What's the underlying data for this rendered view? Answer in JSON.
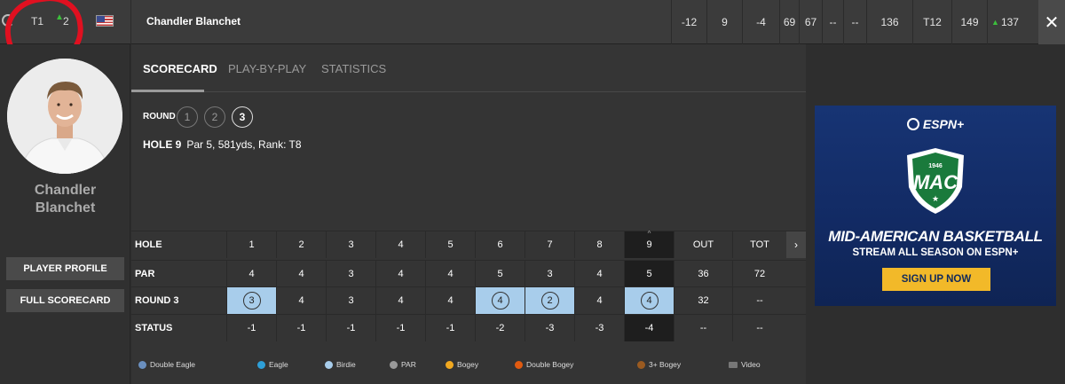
{
  "topbar": {
    "position": "T1",
    "movement": "2",
    "player_name": "Chandler Blanchet",
    "stats": [
      {
        "value": "-12",
        "w": 40
      },
      {
        "value": "9",
        "w": 40
      },
      {
        "value": "-4",
        "w": 42
      },
      {
        "value": "69",
        "w": 22
      },
      {
        "value": "67",
        "w": 26
      },
      {
        "value": "--",
        "w": 24
      },
      {
        "value": "--",
        "w": 26
      },
      {
        "value": "136",
        "w": 52
      },
      {
        "value": "T12",
        "w": 44
      },
      {
        "value": "149",
        "w": 40
      },
      {
        "value": "137",
        "w": 40,
        "up": true
      }
    ],
    "close_icon": "close-icon",
    "colors": {
      "movement_up": "#3cbf3c",
      "annotation": "#e01020"
    }
  },
  "player": {
    "name": "Chandler Blanchet",
    "buttons": {
      "profile": "PLAYER PROFILE",
      "scorecard": "FULL SCORECARD"
    }
  },
  "tabs": [
    "SCORECARD",
    "PLAY-BY-PLAY",
    "STATISTICS"
  ],
  "round": {
    "label": "ROUND",
    "options": [
      "1",
      "2",
      "3"
    ],
    "selected": "3"
  },
  "hole_info": {
    "hole": "HOLE 9",
    "detail": "Par 5, 581yds, Rank: T8"
  },
  "scorecard": {
    "row_labels": [
      "HOLE",
      "PAR",
      "ROUND 3",
      "STATUS"
    ],
    "holes": [
      "1",
      "2",
      "3",
      "4",
      "5",
      "6",
      "7",
      "8",
      "9",
      "OUT",
      "TOT"
    ],
    "par": [
      "4",
      "4",
      "3",
      "4",
      "4",
      "5",
      "3",
      "4",
      "5",
      "36",
      "72"
    ],
    "round3": [
      "3",
      "4",
      "3",
      "4",
      "4",
      "4",
      "2",
      "4",
      "4",
      "32",
      "--"
    ],
    "status": [
      "-1",
      "-1",
      "-1",
      "-1",
      "-1",
      "-2",
      "-3",
      "-3",
      "-4",
      "--",
      "--"
    ],
    "birdie_holes": [
      1,
      6,
      7,
      9
    ],
    "selected_hole": 9
  },
  "legend": [
    {
      "label": "Double Eagle",
      "color": "#6a8fbf"
    },
    {
      "label": "Eagle",
      "color": "#2e9fd8"
    },
    {
      "label": "Birdie",
      "color": "#a8cdeb"
    },
    {
      "label": "PAR",
      "color": "#999999"
    },
    {
      "label": "Bogey",
      "color": "#f0a820"
    },
    {
      "label": "Double Bogey",
      "color": "#e05a10"
    },
    {
      "label": "3+ Bogey",
      "color": "#9a5a20"
    },
    {
      "label": "Video",
      "icon": "video-icon"
    }
  ],
  "ad": {
    "brand": "ESPN+",
    "logo_year": "1946",
    "logo_text": "MAC",
    "title": "MID-AMERICAN BASKETBALL",
    "subtitle": "STREAM ALL SEASON ON ESPN+",
    "cta": "SIGN UP NOW"
  }
}
